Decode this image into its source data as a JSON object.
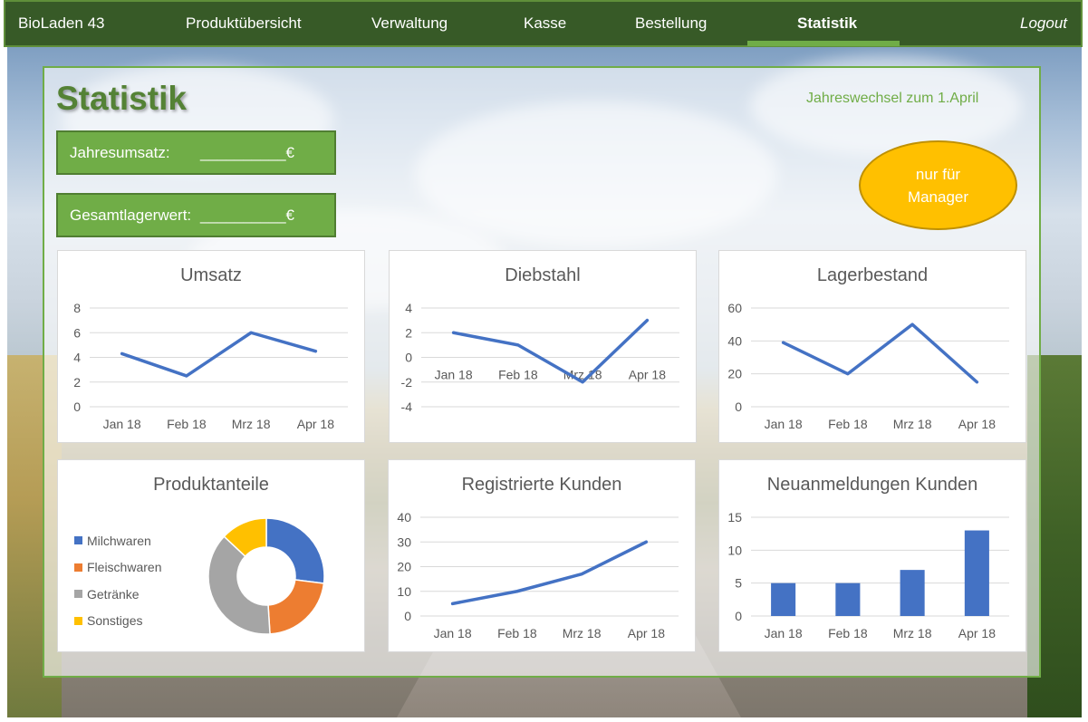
{
  "nav": {
    "brand": "BioLaden 43",
    "items": [
      "Produktübersicht",
      "Verwaltung",
      "Kasse",
      "Bestellung",
      "Statistik"
    ],
    "active": "Statistik",
    "logout": "Logout"
  },
  "page": {
    "title": "Statistik",
    "fiscal_note": "Jahreswechsel zum 1.April",
    "revenue_label": "Jahresumsatz:",
    "revenue_value": "__________€",
    "stock_label": "Gesamtlagerwert:",
    "stock_value": "__________€",
    "manager_badge": "nur für Manager"
  },
  "colors": {
    "nav_bg": "#375a27",
    "accent": "#70ad47",
    "series_blue": "#4472c4",
    "manager": "#ffc000"
  },
  "chart_data": [
    {
      "id": "umsatz",
      "type": "line",
      "title": "Umsatz",
      "categories": [
        "Jan 18",
        "Feb 18",
        "Mrz 18",
        "Apr 18"
      ],
      "values": [
        4.3,
        2.5,
        6,
        4.5
      ],
      "ylim": [
        0,
        8
      ],
      "yticks": [
        0,
        2,
        4,
        6,
        8
      ],
      "grid": true
    },
    {
      "id": "diebstahl",
      "type": "line",
      "title": "Diebstahl",
      "categories": [
        "Jan 18",
        "Feb 18",
        "Mrz 18",
        "Apr 18"
      ],
      "values": [
        2,
        1,
        -2,
        3
      ],
      "ylim": [
        -4,
        4
      ],
      "yticks": [
        -4,
        -2,
        0,
        2,
        4
      ],
      "grid": true
    },
    {
      "id": "lagerbestand",
      "type": "line",
      "title": "Lagerbestand",
      "categories": [
        "Jan 18",
        "Feb 18",
        "Mrz 18",
        "Apr 18"
      ],
      "values": [
        39,
        20,
        50,
        15
      ],
      "ylim": [
        0,
        60
      ],
      "yticks": [
        0,
        20,
        40,
        60
      ],
      "grid": true
    },
    {
      "id": "produktanteile",
      "type": "pie",
      "title": "Produktanteile",
      "categories": [
        "Milchwaren",
        "Fleischwaren",
        "Getränke",
        "Sonstiges"
      ],
      "values": [
        27,
        22,
        38,
        13
      ],
      "colors": [
        "#4472c4",
        "#ed7d31",
        "#a5a5a5",
        "#ffc000"
      ],
      "legend": "left"
    },
    {
      "id": "registrierte",
      "type": "line",
      "title": "Registrierte Kunden",
      "categories": [
        "Jan 18",
        "Feb 18",
        "Mrz 18",
        "Apr 18"
      ],
      "values": [
        5,
        10,
        17,
        30
      ],
      "ylim": [
        0,
        40
      ],
      "yticks": [
        0,
        10,
        20,
        30,
        40
      ],
      "grid": true
    },
    {
      "id": "neuanmeldungen",
      "type": "bar",
      "title": "Neuanmeldungen Kunden",
      "categories": [
        "Jan 18",
        "Feb 18",
        "Mrz 18",
        "Apr 18"
      ],
      "values": [
        5,
        5,
        7,
        13
      ],
      "ylim": [
        0,
        15
      ],
      "yticks": [
        0,
        5,
        10,
        15
      ],
      "grid": true
    }
  ]
}
